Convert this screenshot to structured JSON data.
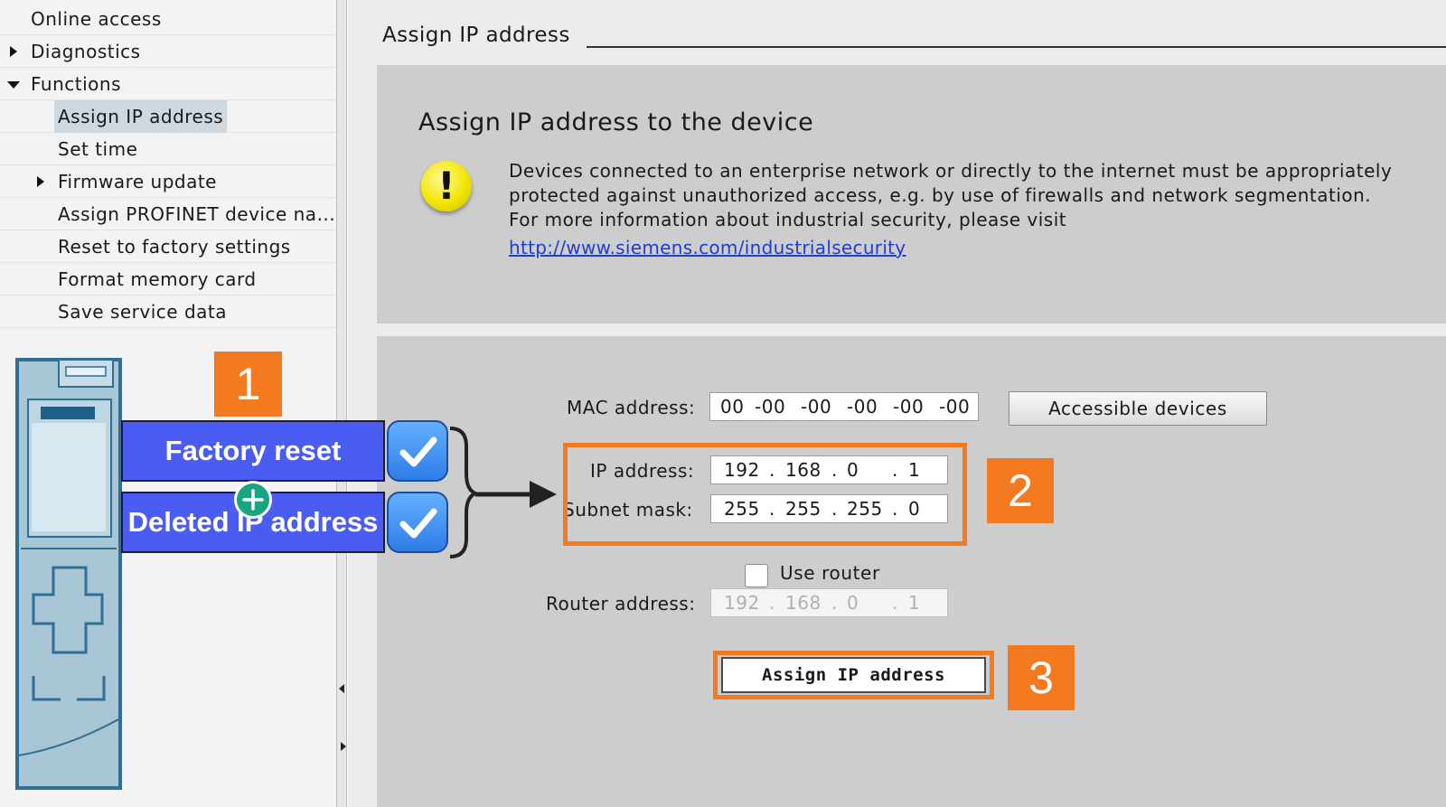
{
  "nav": {
    "items": [
      {
        "label": "Online access"
      },
      {
        "label": "Diagnostics"
      },
      {
        "label": "Functions"
      },
      {
        "label": "Assign IP address"
      },
      {
        "label": "Set time"
      },
      {
        "label": "Firmware update"
      },
      {
        "label": "Assign PROFINET device na..."
      },
      {
        "label": "Reset to factory settings"
      },
      {
        "label": "Format memory card"
      },
      {
        "label": "Save service data"
      }
    ]
  },
  "main": {
    "section_title": "Assign IP address",
    "heading": "Assign IP address to the device",
    "warning_lines": [
      "Devices connected to an enterprise network or directly to the internet must be appropriately",
      "protected against unauthorized access, e.g. by use of firewalls and network segmentation.",
      "For more information about industrial security, please visit"
    ],
    "warning_link": "http://www.siemens.com/industrialsecurity",
    "warning_icon": "warning-icon",
    "mac_label": "MAC address:",
    "mac_parts": [
      "00",
      "-00",
      "-00",
      "-00",
      "-00",
      "-00"
    ],
    "accessible_button": "Accessible devices",
    "ip_label": "IP address:",
    "ip_parts": [
      "192",
      ".",
      "168",
      ".",
      "0",
      ".",
      "1"
    ],
    "subnet_label": "Subnet mask:",
    "subnet_parts": [
      "255",
      ".",
      "255",
      ".",
      "255",
      ".",
      "0"
    ],
    "use_router_label": "Use router",
    "use_router_checked": false,
    "router_label": "Router address:",
    "router_parts": [
      "192",
      ".",
      "168",
      ".",
      "0",
      ".",
      "1"
    ],
    "assign_button": "Assign IP address"
  },
  "annotations": {
    "step1": "1",
    "step2": "2",
    "step3": "3",
    "factory_reset": "Factory reset",
    "deleted_ip": "Deleted IP address",
    "accent_color": "#f47a1f",
    "callout_color": "#4a5cf2"
  }
}
